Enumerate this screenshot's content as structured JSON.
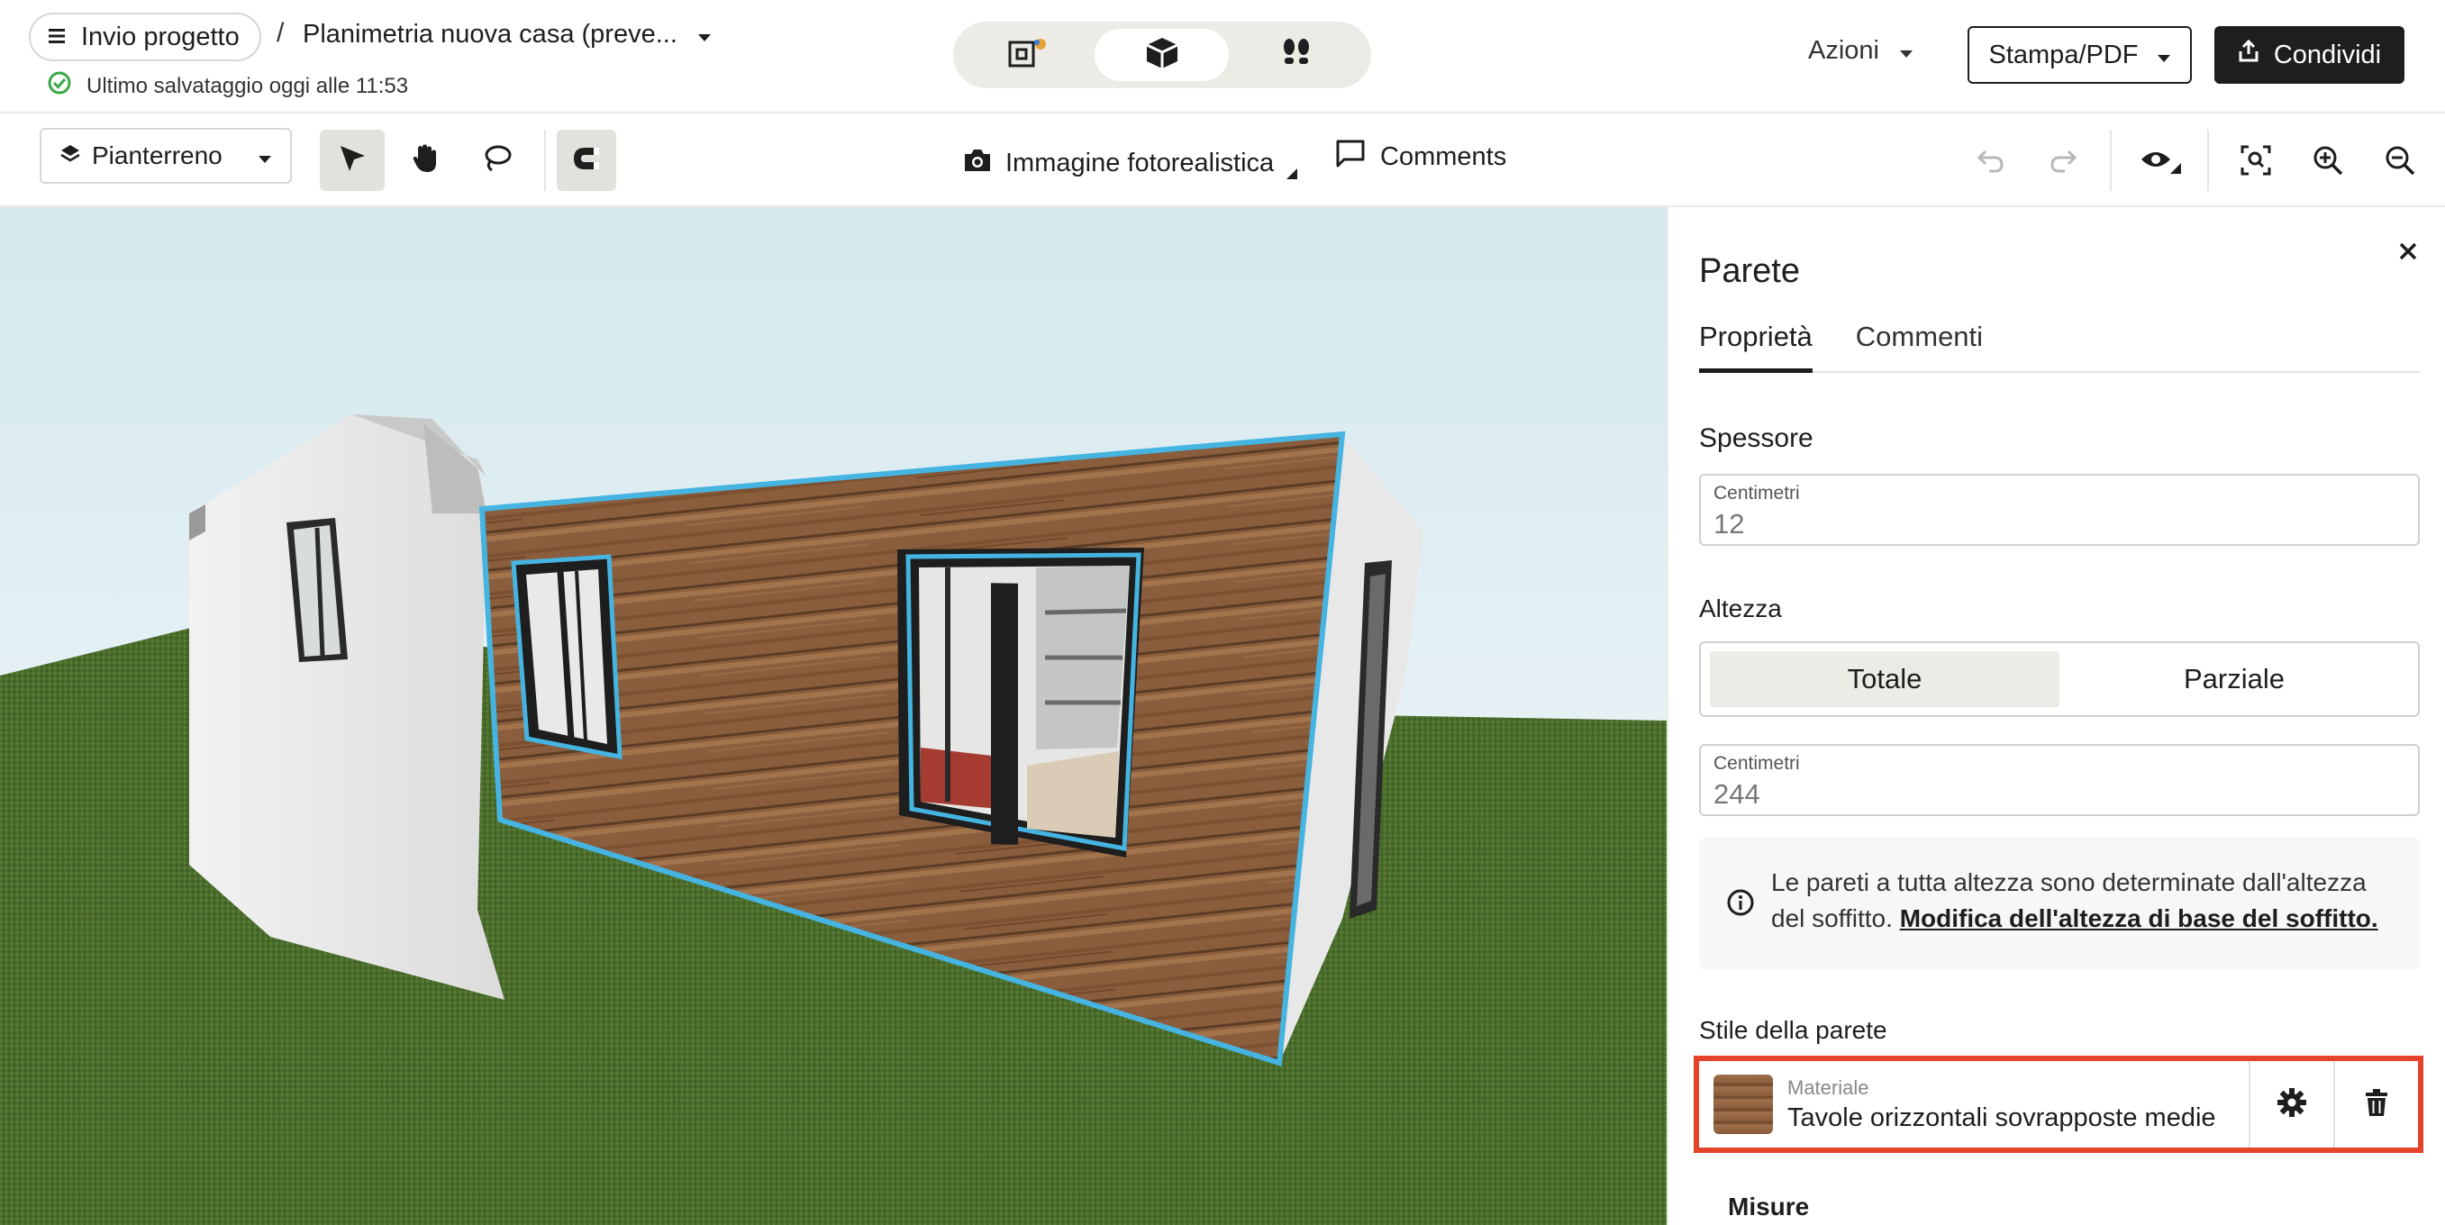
{
  "header": {
    "menu_label": "Invio progetto",
    "breadcrumb_separator": "/",
    "project_title": "Planimetria nuova casa (preve...",
    "save_status": "Ultimo salvataggio oggi alle 11:53",
    "view_modes": [
      "floorplan-2d-icon",
      "view-3d-icon",
      "walkthrough-icon"
    ],
    "active_view": "view-3d-icon",
    "actions_label": "Azioni",
    "print_label": "Stampa/PDF",
    "share_label": "Condividi"
  },
  "toolbar": {
    "floor_label": "Pianterreno",
    "tools": [
      "select-arrow-icon",
      "pan-hand-icon",
      "lasso-icon",
      "magnet-icon"
    ],
    "photo_label": "Immagine fotorealistica",
    "comments_label": "Comments"
  },
  "panel": {
    "title": "Parete",
    "tabs": [
      "Proprietà",
      "Commenti"
    ],
    "active_tab": "Proprietà",
    "thickness": {
      "section": "Spessore",
      "unit_label": "Centimetri",
      "value": "12"
    },
    "height": {
      "section": "Altezza",
      "options": [
        "Totale",
        "Parziale"
      ],
      "active": "Totale",
      "unit_label": "Centimetri",
      "value": "244"
    },
    "info": {
      "text": "Le pareti a tutta altezza sono determinate dall'altezza del soffitto.",
      "link": "Modifica dell'altezza di base del soffitto."
    },
    "wall_style": {
      "section": "Stile della parete",
      "material_label": "Materiale",
      "material_name": "Tavole orizzontali sovrapposte medie"
    },
    "measures_label": "Misure"
  },
  "colors": {
    "accent_dark": "#1e1e1e",
    "highlight_red": "#e5432b",
    "selection_blue": "#45b4e0",
    "wood": "#8a5d3c",
    "grass": "#4a6b2c"
  }
}
